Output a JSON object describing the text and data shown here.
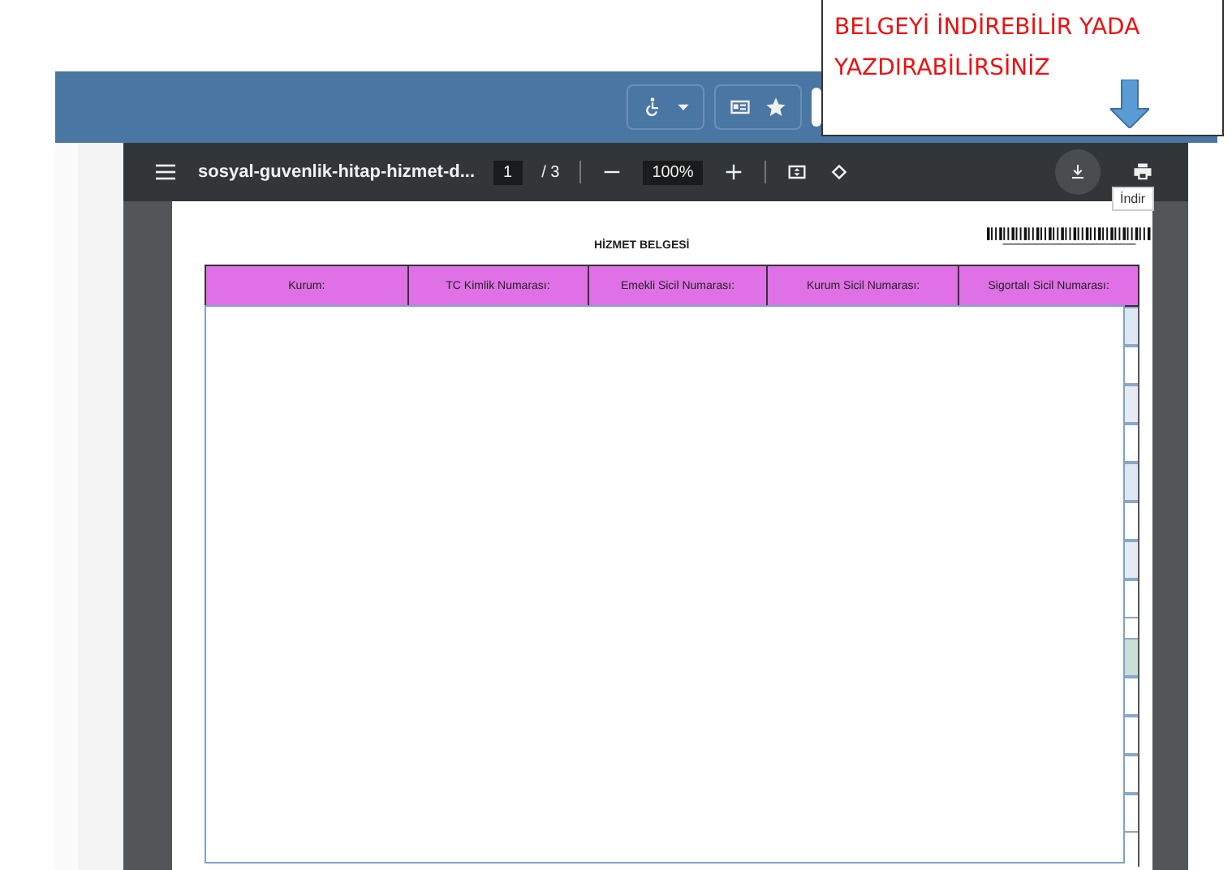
{
  "callout": {
    "text": "BELGEYİ İNDİREBİLİR YADA YAZDIRABİLİRSİNİZ"
  },
  "viewer": {
    "file_name": "sosyal-guvenlik-hitap-hizmet-d...",
    "page": "1",
    "page_count": "/ 3",
    "zoom": "100%",
    "tooltip": "İndir"
  },
  "document": {
    "title": "HİZMET BELGESİ",
    "columns": [
      "Kurum:",
      "TC Kimlik Numarası:",
      "Emekli Sicil Numarası:",
      "Kurum Sicil Numarası:",
      "Sigortalı Sicil Numarası:"
    ]
  }
}
